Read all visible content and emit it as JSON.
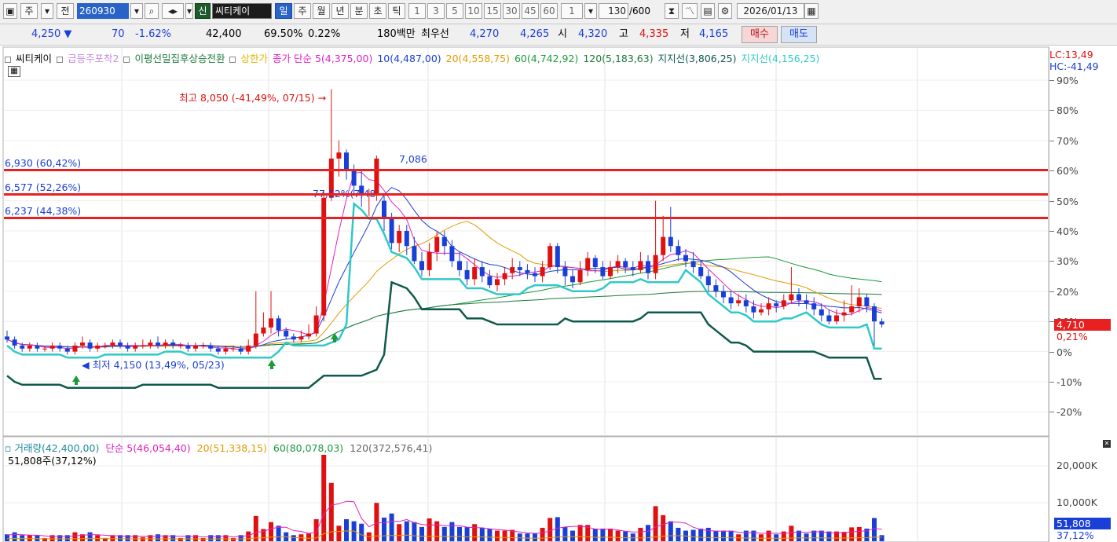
{
  "toolbar": {
    "market": "주",
    "period_prefix": "전",
    "code": "260930",
    "new_badge": "신",
    "name": "씨티케이",
    "tabs": [
      "일",
      "주",
      "월",
      "년",
      "분",
      "초",
      "틱"
    ],
    "active_tab": "일",
    "intervals": [
      "1",
      "3",
      "5",
      "10",
      "15",
      "30",
      "45",
      "60"
    ],
    "unit_value": "1",
    "count": "130",
    "count_total": "/600",
    "date": "2026/01/13"
  },
  "quote": {
    "price": "4,250",
    "arrow": "▼",
    "change": "70",
    "change_pct": "-1.62%",
    "volume": "42,400",
    "volume_ratio": "69.50%",
    "turnover_rate": "0.22%",
    "amount": "180백만",
    "best_ask_label": "최우선",
    "best_ask": "4,270",
    "best_bid": "4,265",
    "open_label": "시",
    "open": "4,320",
    "high_label": "고",
    "high": "4,335",
    "low_label": "저",
    "low": "4,165",
    "buy_button": "매수",
    "sell_button": "매도"
  },
  "legend": {
    "items": [
      {
        "text": "씨티케이",
        "color": "#000000"
      },
      {
        "text": "급등주포착2",
        "color": "#c78de0"
      },
      {
        "text": "이평선밀집후상승전환",
        "color": "#1b7a3a"
      },
      {
        "text": "상한가",
        "color": "#e0b400"
      },
      {
        "text": "종가 단순 5(4,375,00)",
        "color": "#e020c0"
      },
      {
        "text": "10(4,487,00)",
        "color": "#1a3fd6"
      },
      {
        "text": "20(4,558,75)",
        "color": "#e39a00"
      },
      {
        "text": "60(4,742,92)",
        "color": "#1b9a3a"
      },
      {
        "text": "120(5,183,63)",
        "color": "#1b7a3a"
      },
      {
        "text": "지지선(3,806,25)",
        "color": "#0f5a4a"
      },
      {
        "text": "지지선(4,156,25)",
        "color": "#30c8c8"
      }
    ]
  },
  "annotations": {
    "high": "최고 8,050 (-41,49%, 07/15) →",
    "low": "최저 4,150 (13,49%, 05/23)",
    "peak_label": "7,086",
    "mid_label": "77,12%(7,48",
    "lc": "LC:13,49",
    "hc": "HC:-41,49"
  },
  "resistance": [
    {
      "label": "6,930 (60,42%)",
      "pct": 60.42
    },
    {
      "label": "6,577 (52,26%)",
      "pct": 52.26
    },
    {
      "label": "6,237 (44,38%)",
      "pct": 44.38
    }
  ],
  "current_price": {
    "value": "4,710",
    "pct": "0,21%"
  },
  "price_axis": [
    "90%",
    "80%",
    "70%",
    "60%",
    "50%",
    "40%",
    "30%",
    "20%",
    "10%",
    "0%",
    "-10%",
    "-20%"
  ],
  "volume_panel": {
    "legend": [
      {
        "text": "거래량(42,400,00)",
        "color": "#1a8a9a"
      },
      {
        "text": "단순 5(46,054,40)",
        "color": "#e020c0"
      },
      {
        "text": "20(51,338,15)",
        "color": "#e39a00"
      },
      {
        "text": "60(80,078,03)",
        "color": "#1b9a3a"
      },
      {
        "text": "120(372,576,41)",
        "color": "#666666"
      }
    ],
    "sub": "51,808주(37,12%)",
    "axis": [
      "20,000K",
      "10,000K"
    ],
    "current": {
      "value": "51,808",
      "pct": "37,12%"
    }
  },
  "colors": {
    "up": "#e01010",
    "down": "#1a3fd6",
    "support_dark": "#0f5a4a",
    "support_light": "#30c8c8",
    "resistance": "#e82020"
  },
  "chart_data": {
    "type": "candlestick",
    "y_axis": "percent",
    "ylim": [
      -28,
      92
    ],
    "note": "values in chart percent-axis units",
    "candles": [
      [
        5,
        4,
        7,
        3
      ],
      [
        4,
        2,
        5,
        1
      ],
      [
        2,
        1,
        3,
        0
      ],
      [
        1,
        2,
        3,
        0
      ],
      [
        2,
        1,
        3,
        0
      ],
      [
        1,
        1,
        2,
        0
      ],
      [
        1,
        2,
        3,
        0
      ],
      [
        2,
        1,
        3,
        0
      ],
      [
        1,
        0,
        2,
        -1
      ],
      [
        0,
        2,
        3,
        -1
      ],
      [
        2,
        3,
        5,
        1
      ],
      [
        3,
        1,
        4,
        0
      ],
      [
        1,
        2,
        3,
        0
      ],
      [
        2,
        2,
        3,
        1
      ],
      [
        2,
        3,
        4,
        1
      ],
      [
        3,
        2,
        4,
        1
      ],
      [
        2,
        1,
        3,
        0
      ],
      [
        1,
        2,
        3,
        0
      ],
      [
        2,
        2,
        4,
        1
      ],
      [
        2,
        3,
        4,
        1
      ],
      [
        3,
        2,
        5,
        1
      ],
      [
        2,
        3,
        4,
        1
      ],
      [
        3,
        2,
        4,
        1
      ],
      [
        2,
        2,
        3,
        1
      ],
      [
        2,
        1,
        3,
        0
      ],
      [
        1,
        2,
        3,
        0
      ],
      [
        2,
        2,
        3,
        1
      ],
      [
        2,
        1,
        3,
        0
      ],
      [
        1,
        0,
        2,
        -1
      ],
      [
        0,
        1,
        2,
        -1
      ],
      [
        1,
        1,
        2,
        0
      ],
      [
        1,
        0,
        2,
        -1
      ],
      [
        0,
        2,
        4,
        -1
      ],
      [
        2,
        6,
        20,
        1
      ],
      [
        6,
        8,
        13,
        5
      ],
      [
        8,
        11,
        20,
        6
      ],
      [
        11,
        7,
        12,
        5
      ],
      [
        7,
        5,
        8,
        4
      ],
      [
        5,
        4,
        6,
        3
      ],
      [
        4,
        5,
        7,
        3
      ],
      [
        5,
        6,
        9,
        4
      ],
      [
        6,
        12,
        15,
        5
      ],
      [
        12,
        51,
        53,
        10
      ],
      [
        51,
        64,
        87,
        50
      ],
      [
        64,
        66,
        70,
        58
      ],
      [
        66,
        60,
        67,
        57
      ],
      [
        60,
        55,
        62,
        52
      ],
      [
        55,
        52,
        60,
        48
      ],
      [
        52,
        52,
        54,
        45
      ],
      [
        52,
        64,
        65,
        50
      ],
      [
        50,
        44,
        52,
        40
      ],
      [
        44,
        36,
        46,
        34
      ],
      [
        36,
        40,
        42,
        33
      ],
      [
        40,
        35,
        42,
        32
      ],
      [
        35,
        30,
        38,
        29
      ],
      [
        30,
        27,
        33,
        25
      ],
      [
        27,
        33,
        36,
        25
      ],
      [
        33,
        38,
        40,
        30
      ],
      [
        38,
        35,
        40,
        32
      ],
      [
        35,
        30,
        37,
        28
      ],
      [
        30,
        27,
        33,
        25
      ],
      [
        27,
        24,
        30,
        22
      ],
      [
        24,
        28,
        31,
        22
      ],
      [
        28,
        25,
        30,
        23
      ],
      [
        25,
        22,
        27,
        21
      ],
      [
        22,
        24,
        26,
        20
      ],
      [
        24,
        26,
        28,
        22
      ],
      [
        26,
        28,
        31,
        24
      ],
      [
        28,
        27,
        30,
        25
      ],
      [
        27,
        26,
        29,
        24
      ],
      [
        26,
        25,
        28,
        23
      ],
      [
        25,
        28,
        30,
        23
      ],
      [
        28,
        35,
        36,
        27
      ],
      [
        35,
        28,
        36,
        26
      ],
      [
        28,
        25,
        30,
        22
      ],
      [
        25,
        23,
        27,
        21
      ],
      [
        23,
        27,
        30,
        22
      ],
      [
        27,
        31,
        33,
        25
      ],
      [
        31,
        28,
        32,
        26
      ],
      [
        28,
        25,
        30,
        24
      ],
      [
        25,
        28,
        30,
        24
      ],
      [
        28,
        30,
        32,
        26
      ],
      [
        30,
        28,
        31,
        26
      ],
      [
        28,
        27,
        30,
        25
      ],
      [
        27,
        30,
        33,
        26
      ],
      [
        30,
        26,
        32,
        24
      ],
      [
        26,
        32,
        50,
        24
      ],
      [
        32,
        38,
        45,
        30
      ],
      [
        38,
        35,
        48,
        33
      ],
      [
        35,
        32,
        37,
        30
      ],
      [
        32,
        30,
        34,
        28
      ],
      [
        30,
        28,
        33,
        26
      ],
      [
        28,
        25,
        30,
        24
      ],
      [
        25,
        22,
        27,
        20
      ],
      [
        22,
        20,
        24,
        18
      ],
      [
        20,
        18,
        22,
        16
      ],
      [
        18,
        16,
        20,
        14
      ],
      [
        16,
        17,
        19,
        15
      ],
      [
        17,
        15,
        19,
        13
      ],
      [
        15,
        13,
        17,
        11
      ],
      [
        13,
        14,
        16,
        12
      ],
      [
        14,
        16,
        18,
        12
      ],
      [
        16,
        15,
        17,
        13
      ],
      [
        15,
        17,
        19,
        14
      ],
      [
        17,
        19,
        28,
        16
      ],
      [
        19,
        17,
        21,
        15
      ],
      [
        17,
        16,
        19,
        14
      ],
      [
        16,
        14,
        18,
        12
      ],
      [
        14,
        12,
        16,
        10
      ],
      [
        12,
        10,
        14,
        9
      ],
      [
        10,
        12,
        14,
        9
      ],
      [
        12,
        13,
        17,
        10
      ],
      [
        13,
        15,
        22,
        12
      ],
      [
        15,
        18,
        21,
        13
      ],
      [
        18,
        15,
        19,
        13
      ],
      [
        15,
        10,
        16,
        2
      ],
      [
        10,
        9,
        11,
        8
      ]
    ]
  }
}
